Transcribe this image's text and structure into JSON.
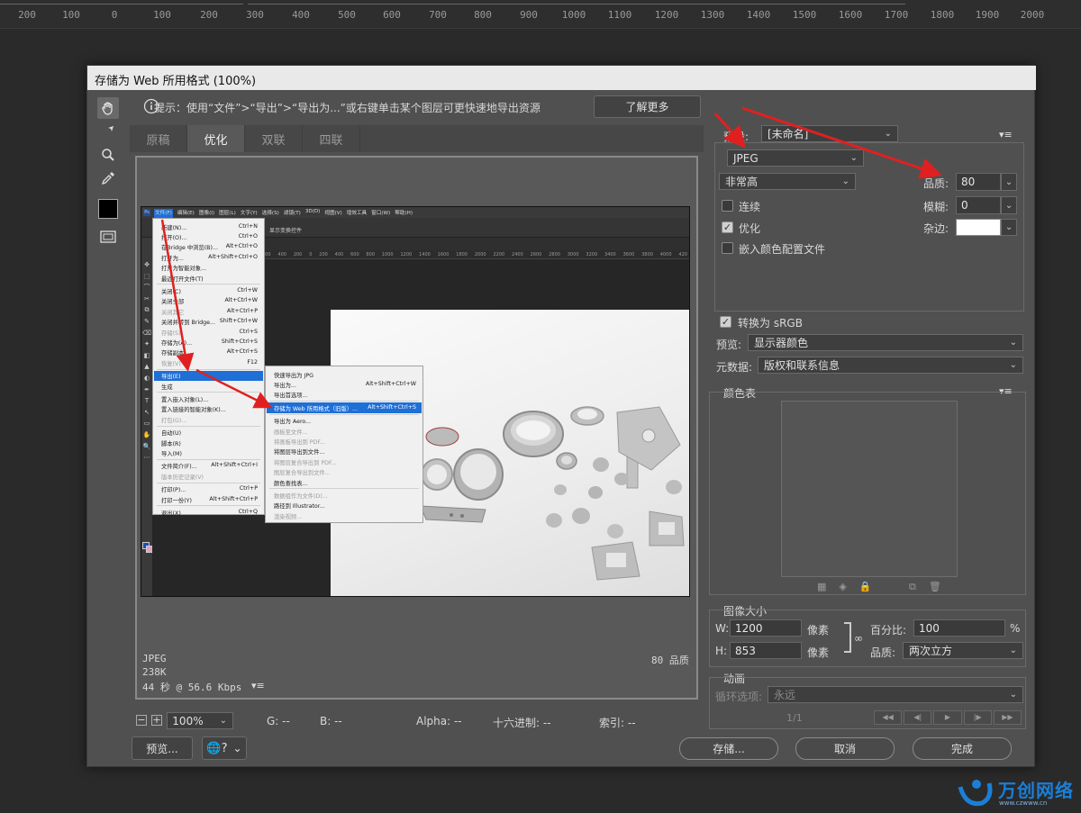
{
  "ruler": {
    "ticks": [
      "200",
      "100",
      "0",
      "100",
      "200",
      "300",
      "400",
      "500",
      "600",
      "700",
      "800",
      "900",
      "1000",
      "1100",
      "1200",
      "1300",
      "1400",
      "1500",
      "1600",
      "1700",
      "1800",
      "1900",
      "2000"
    ]
  },
  "dialog": {
    "title": "存储为 Web 所用格式 (100%)",
    "hint": "提示：使用“文件”>“导出”>“导出为...”或右键单击某个图层可更快速地导出资源",
    "learn_more": "了解更多",
    "tabs": [
      "原稿",
      "优化",
      "双联",
      "四联"
    ],
    "active_tab": "优化",
    "preview_info": {
      "format": "JPEG",
      "size": "238K",
      "time": "44 秒 @ 56.6 Kbps",
      "quality": "80 品质"
    },
    "status_bar": {
      "zoom": "100%",
      "g": "G: --",
      "b": "B: --",
      "alpha": "Alpha: --",
      "hex": "十六进制: --",
      "index": "索引: --"
    },
    "buttons": {
      "preview": "预览...",
      "save": "存储...",
      "cancel": "取消",
      "done": "完成"
    }
  },
  "settings": {
    "preset_label": "预设:",
    "preset_value": "[未命名]",
    "format": "JPEG",
    "compression": "非常高",
    "quality_label": "品质:",
    "quality_value": "80",
    "progressive_label": "连续",
    "progressive_checked": false,
    "blur_label": "模糊:",
    "blur_value": "0",
    "optimized_label": "优化",
    "optimized_checked": true,
    "matte_label": "杂边:",
    "embed_profile_label": "嵌入颜色配置文件",
    "embed_profile_checked": false,
    "convert_srgb_label": "转换为 sRGB",
    "convert_srgb_checked": true,
    "preview_label": "预览:",
    "preview_value": "显示器颜色",
    "metadata_label": "元数据:",
    "metadata_value": "版权和联系信息",
    "color_table_title": "颜色表"
  },
  "image_size": {
    "title": "图像大小",
    "w_label": "W:",
    "w_value": "1200",
    "h_label": "H:",
    "h_value": "853",
    "unit": "像素",
    "percent_label": "百分比:",
    "percent_value": "100",
    "percent_unit": "%",
    "quality_label": "品质:",
    "quality_value": "两次立方"
  },
  "animation": {
    "title": "动画",
    "loop_label": "循环选项:",
    "loop_value": "永远",
    "frame": "1/1"
  },
  "inner_screenshot": {
    "menubar": [
      "文件(F)",
      "编辑(E)",
      "图像(I)",
      "图层(L)",
      "文字(Y)",
      "选择(S)",
      "滤镜(T)",
      "3D(D)",
      "视图(V)",
      "增效工具",
      "窗口(W)",
      "帮助(H)"
    ],
    "file_menu": [
      {
        "label": "新建(N)...",
        "shortcut": "Ctrl+N"
      },
      {
        "label": "打开(O)...",
        "shortcut": "Ctrl+O"
      },
      {
        "label": "在Bridge 中浏览(B)...",
        "shortcut": "Alt+Ctrl+O"
      },
      {
        "label": "打开为...",
        "shortcut": "Alt+Shift+Ctrl+O"
      },
      {
        "label": "打开为智能对象...",
        "shortcut": ""
      },
      {
        "label": "最近打开文件(T)",
        "shortcut": ""
      },
      {
        "label": "关闭(C)",
        "shortcut": "Ctrl+W"
      },
      {
        "label": "关闭全部",
        "shortcut": "Alt+Ctrl+W"
      },
      {
        "label": "关闭其它",
        "shortcut": "Alt+Ctrl+P"
      },
      {
        "label": "关闭并转到 Bridge...",
        "shortcut": "Shift+Ctrl+W"
      },
      {
        "label": "存储(S)",
        "shortcut": "Ctrl+S"
      },
      {
        "label": "存储为(A)...",
        "shortcut": "Shift+Ctrl+S"
      },
      {
        "label": "存储副本...",
        "shortcut": "Alt+Ctrl+S"
      },
      {
        "label": "恢复(V)",
        "shortcut": "F12"
      },
      {
        "label": "导出(E)",
        "shortcut": ""
      },
      {
        "label": "生成",
        "shortcut": ""
      },
      {
        "label": "置入嵌入对象(L)...",
        "shortcut": ""
      },
      {
        "label": "置入链接的智能对象(K)...",
        "shortcut": ""
      },
      {
        "label": "打包(G)...",
        "shortcut": ""
      },
      {
        "label": "自动(U)",
        "shortcut": ""
      },
      {
        "label": "脚本(R)",
        "shortcut": ""
      },
      {
        "label": "导入(M)",
        "shortcut": ""
      },
      {
        "label": "文件简介(F)...",
        "shortcut": "Alt+Shift+Ctrl+I"
      },
      {
        "label": "版本历史记录(V)",
        "shortcut": ""
      },
      {
        "label": "打印(P)...",
        "shortcut": "Ctrl+P"
      },
      {
        "label": "打印一份(Y)",
        "shortcut": "Alt+Shift+Ctrl+P"
      },
      {
        "label": "退出(X)",
        "shortcut": "Ctrl+Q"
      }
    ],
    "export_menu": [
      {
        "label": "快速导出为 JPG",
        "shortcut": ""
      },
      {
        "label": "导出为...",
        "shortcut": "Alt+Shift+Ctrl+W"
      },
      {
        "label": "导出首选项...",
        "shortcut": ""
      },
      {
        "label": "存储为 Web 所用格式（旧版）...",
        "shortcut": "Alt+Shift+Ctrl+S"
      },
      {
        "label": "导出为 Aero...",
        "shortcut": ""
      },
      {
        "label": "画板至文件...",
        "shortcut": ""
      },
      {
        "label": "将画板导出到 PDF...",
        "shortcut": ""
      },
      {
        "label": "将图层导出到文件...",
        "shortcut": ""
      },
      {
        "label": "将图层复合导出到 PDF...",
        "shortcut": ""
      },
      {
        "label": "图层复合导出到文件...",
        "shortcut": ""
      },
      {
        "label": "颜色查找表...",
        "shortcut": ""
      },
      {
        "label": "数据组作为文件(D)...",
        "shortcut": ""
      },
      {
        "label": "路径到 Illustrator...",
        "shortcut": ""
      },
      {
        "label": "渲染视频...",
        "shortcut": ""
      }
    ],
    "ruler_ticks": [
      "600",
      "400",
      "200",
      "0",
      "200",
      "400",
      "600",
      "800",
      "1000",
      "1200",
      "1400",
      "1600",
      "1800",
      "2000",
      "2200",
      "2400",
      "2600",
      "2800",
      "3000",
      "3200",
      "3400",
      "3600",
      "3800",
      "4000",
      "420"
    ],
    "options_text": "显示变换控件"
  },
  "watermark": {
    "brand": "万创网络",
    "url": "www.czwww.cn"
  },
  "colors": {
    "dialog_bg": "#505050",
    "arrow": "#e02020",
    "highlight": "#1e6fd6",
    "brand": "#1a7fd8"
  }
}
